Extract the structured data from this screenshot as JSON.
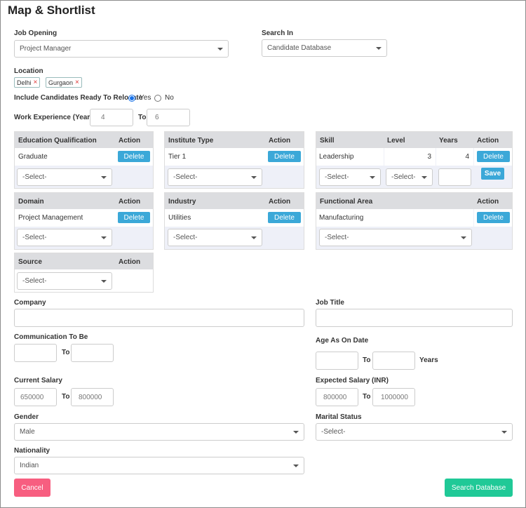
{
  "title": "Map & Shortlist",
  "job_opening": {
    "label": "Job Opening",
    "value": "Project Manager"
  },
  "search_in": {
    "label": "Search In",
    "value": "Candidate Database"
  },
  "location": {
    "label": "Location",
    "tags": [
      "Delhi",
      "Gurgaon"
    ]
  },
  "relocate": {
    "label": "Include Candidates Ready To Relocate",
    "yes": "Yes",
    "no": "No",
    "selected": "Yes"
  },
  "work_experience": {
    "label": "Work Experience (Years)",
    "from": "4",
    "to_label": "To",
    "to": "6"
  },
  "education": {
    "header": "Education Qualification",
    "action": "Action",
    "value": "Graduate",
    "delete": "Delete",
    "select": "-Select-"
  },
  "institute": {
    "header": "Institute Type",
    "action": "Action",
    "value": "Tier 1",
    "delete": "Delete",
    "select": "-Select-"
  },
  "skill": {
    "header_skill": "Skill",
    "header_level": "Level",
    "header_years": "Years",
    "action": "Action",
    "value": "Leadership",
    "level": "3",
    "years": "4",
    "delete": "Delete",
    "select_skill": "-Select-",
    "select_level": "-Select-",
    "save": "Save"
  },
  "domain": {
    "header": "Domain",
    "action": "Action",
    "value": "Project Management",
    "delete": "Delete",
    "select": "-Select-"
  },
  "industry": {
    "header": "Industry",
    "action": "Action",
    "value": "Utilities",
    "delete": "Delete",
    "select": "-Select-"
  },
  "functional_area": {
    "header": "Functional Area",
    "action": "Action",
    "value": "Manufacturing",
    "delete": "Delete",
    "select": "-Select-"
  },
  "source": {
    "header": "Source",
    "action": "Action",
    "select": "-Select-"
  },
  "company": {
    "label": "Company",
    "value": ""
  },
  "job_title": {
    "label": "Job Title",
    "value": ""
  },
  "communication": {
    "label": "Communication To Be",
    "to_label": "To"
  },
  "age": {
    "label": "Age As On Date",
    "to_label": "To",
    "years_label": "Years"
  },
  "current_salary": {
    "label": "Current Salary",
    "from": "650000",
    "to_label": "To",
    "to": "800000"
  },
  "expected_salary": {
    "label": "Expected Salary (INR)",
    "from": "800000",
    "to_label": "To",
    "to": "1000000"
  },
  "gender": {
    "label": "Gender",
    "value": "Male"
  },
  "marital_status": {
    "label": "Marital Status",
    "value": "-Select-"
  },
  "nationality": {
    "label": "Nationality",
    "value": "Indian"
  },
  "cancel": "Cancel",
  "search": "Search Database",
  "colors": {
    "delete": "#3ba8d8",
    "cancel": "#f75e80",
    "search": "#20c997",
    "panel_bg": "#eef0f8",
    "panel_head": "#dcdde0"
  }
}
